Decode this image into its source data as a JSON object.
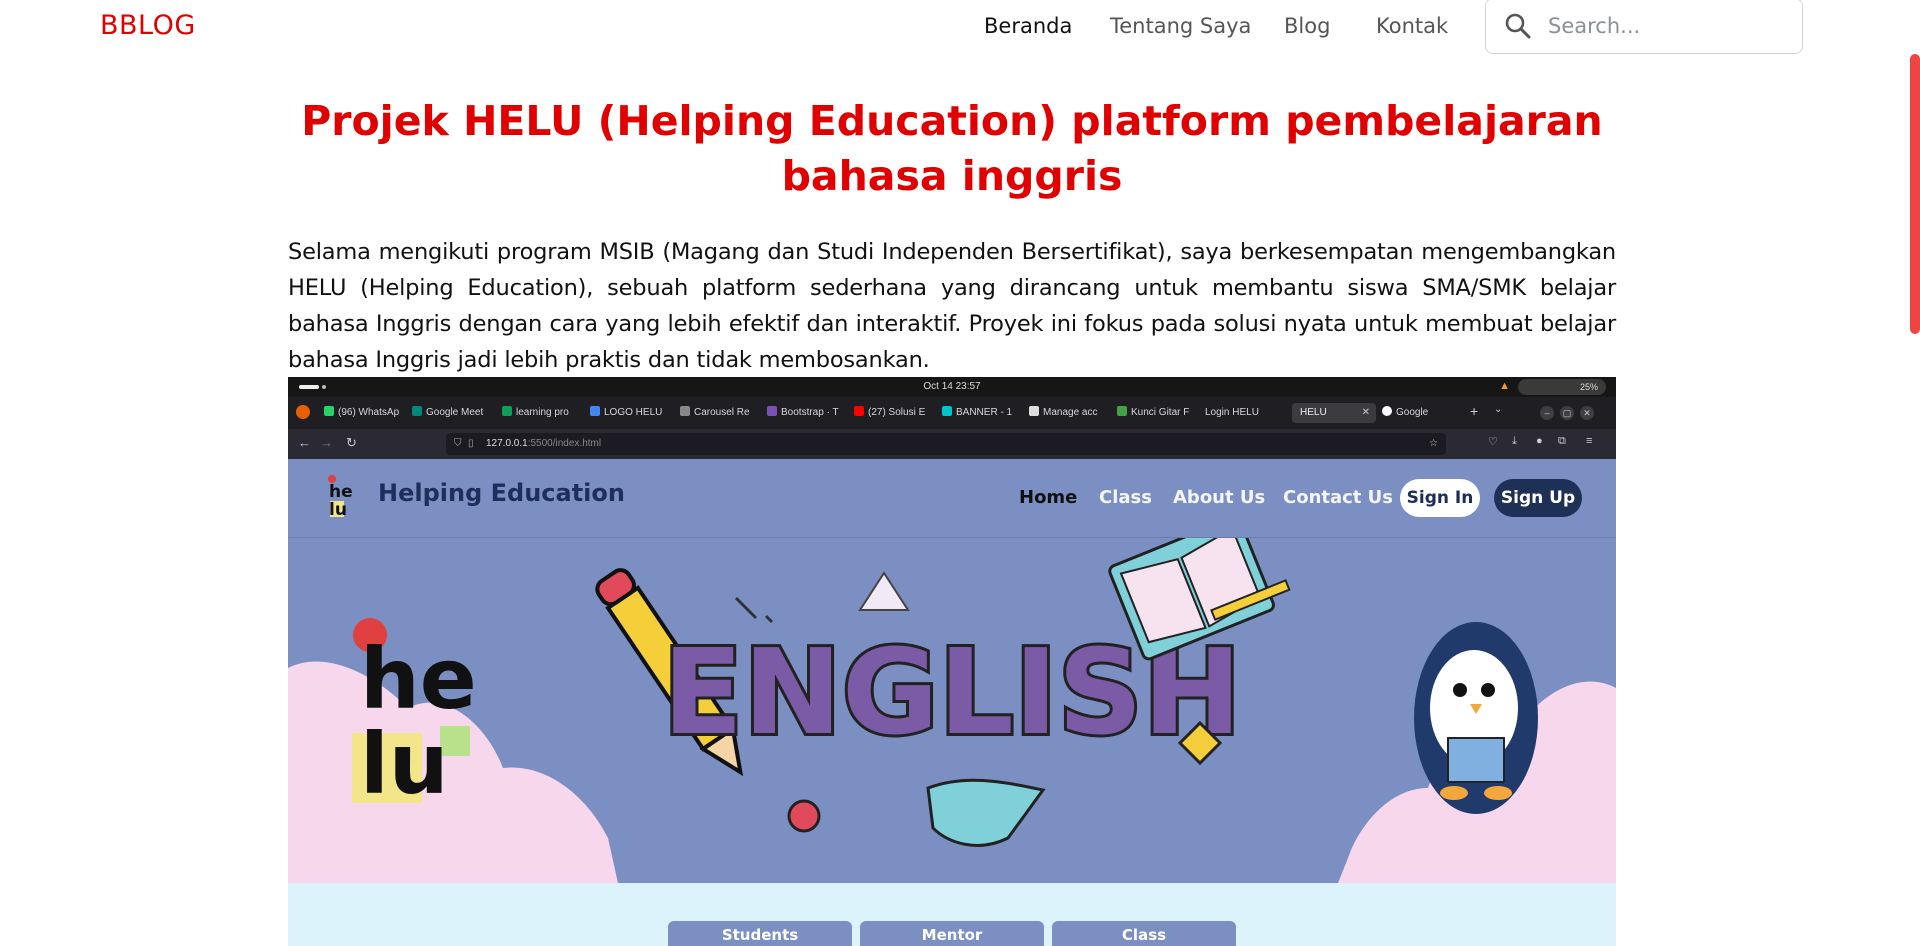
{
  "navbar": {
    "brand": "BBLOG",
    "links": [
      "Beranda",
      "Tentang Saya",
      "Blog",
      "Kontak"
    ],
    "search_placeholder": "Search..."
  },
  "article": {
    "title": "Projek HELU (Helping Education) platform pembelajaran bahasa inggris",
    "body": "Selama mengikuti program MSIB (Magang dan Studi Independen Bersertifikat), saya berkesempatan mengembangkan HELU (Helping Education), sebuah platform sederhana yang dirancang untuk membantu siswa SMA/SMK belajar bahasa Inggris dengan cara yang lebih efektif dan interaktif. Proyek ini fokus pada solusi nyata untuk membuat belajar bahasa Inggris jadi lebih praktis dan tidak membosankan."
  },
  "screenshot": {
    "system_clock": "Oct 14  23:57",
    "battery": "25%",
    "tabs": [
      "(96) WhatsAp",
      "Google Meet",
      "learning pro",
      "LOGO HELU",
      "Carousel Re",
      "Bootstrap · T",
      "(27) Solusi E",
      "BANNER - 1",
      "Manage acc",
      "Kunci Gitar F",
      "Login HELU",
      "HELU",
      "Google"
    ],
    "url_host": "127.0.0.1",
    "url_rest": ":5500/index.html",
    "site": {
      "name": "Helping Education",
      "nav": [
        "Home",
        "Class",
        "About Us",
        "Contact Us"
      ],
      "sign_in": "Sign In",
      "sign_up": "Sign Up"
    },
    "hero_word": "ENGLISH",
    "lower_tabs": [
      "Students",
      "Mentor",
      "Class"
    ]
  },
  "colors": {
    "brand_red": "#e00000",
    "site_blue": "#7b8fc2",
    "site_navy": "#1f3057",
    "hero_purple": "#7b5aa6",
    "cloud_pink": "#f6d7ec"
  },
  "icons": [
    "search-icon",
    "firefox-icon",
    "back-icon",
    "forward-icon",
    "reload-icon",
    "shield-icon",
    "star-icon",
    "penguin-icon",
    "pencil-icon",
    "book-icon"
  ]
}
